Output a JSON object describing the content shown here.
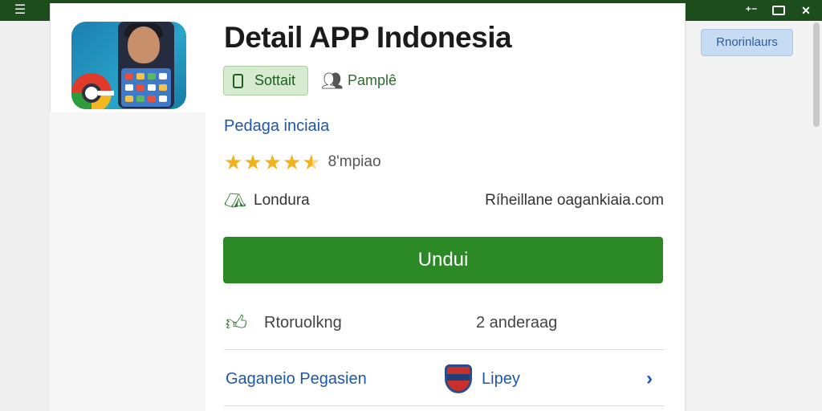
{
  "app": {
    "title": "Detail APP Indonesia",
    "tag_primary": "Sottait",
    "tag_people": "Pamplê",
    "developer": "Pedaga inciaia",
    "rating": 4.5,
    "rating_count": "8'mpiao",
    "category": "Londura",
    "website": "Ríheillane oagankiaia.com",
    "install_label": "Undui",
    "stats_label": "Rtoruolkng",
    "stats_value": "2 anderaag",
    "publisher_label": "Gaganeio Pegasien",
    "publisher_name": "Lipey"
  },
  "sidebar": {
    "button_label": "Rnorinlaurs"
  },
  "icons": {
    "menu": "menu-icon",
    "minimize": "minimize-icon",
    "restore": "restore-icon",
    "close": "close-icon",
    "device": "phone-icon",
    "people": "people-icon",
    "category": "category-icon",
    "thumb": "thumbs-up-icon",
    "chevron": "chevron-right-icon"
  },
  "colors": {
    "topbar": "#1d4d1d",
    "install": "#2b8a26",
    "link": "#1f57a8",
    "star": "#f2b21c"
  }
}
